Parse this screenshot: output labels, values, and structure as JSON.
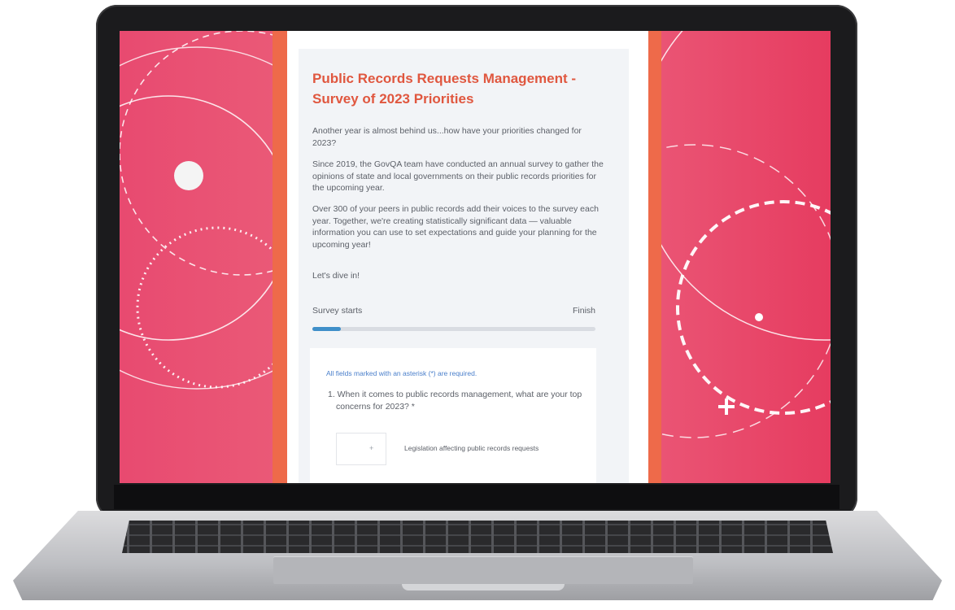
{
  "survey": {
    "title": "Public Records Requests Management - Survey of 2023 Priorities",
    "paragraphs": [
      "Another year is almost behind us...how have your priorities changed for 2023?",
      "Since 2019, the GovQA team have conducted an annual survey to gather the opinions of state and local governments on their public records priorities for the upcoming year.",
      "Over 300 of your peers in public records add their voices to the survey each year. Together, we're creating statistically significant data — valuable information you can use to set expectations and guide your planning for the upcoming year!",
      "Let's dive in!"
    ],
    "progress": {
      "start_label": "Survey starts",
      "end_label": "Finish",
      "fraction": 0.1
    },
    "form": {
      "required_note": "All fields marked with an asterisk (*) are required.",
      "question": "1. When it comes to public records management, what are your top concerns for 2023? *",
      "option_marker": "+",
      "option_label": "Legislation affecting public records requests"
    }
  },
  "colors": {
    "side_pink": "#e84a70",
    "stripe_orange": "#ee6a4a",
    "title_orange": "#e0573f",
    "progress_blue": "#3f8fc9",
    "note_blue": "#4a7fcb"
  }
}
